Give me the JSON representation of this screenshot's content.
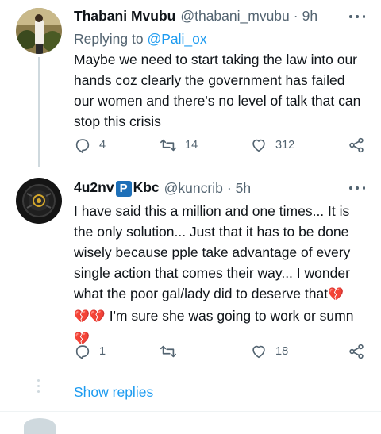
{
  "tweets": [
    {
      "name": "Thabani Mvubu",
      "handle": "@thabani_mvubu",
      "time": "9h",
      "replying_label": "Replying to",
      "replying_to": "@Pali_ox",
      "text": "Maybe we need to start taking the law into our hands coz clearly the government has failed our women and there's no level of talk that can stop this crisis",
      "replies": "4",
      "retweets": "14",
      "likes": "312"
    },
    {
      "name_prefix": "4u2nv",
      "name_badge": "P",
      "name_suffix": "Kbc",
      "handle": "@kuncrib",
      "time": "5h",
      "text": "I have said this a million and one times... It is the only solution... Just that it has to be done wisely because pple take advantage of every single action that comes their way... I wonder what the poor gal/lady did to deserve that",
      "text_hearts_1": "💔",
      "text_line2_hearts": "💔💔",
      "text_cont": " I'm sure she was going to work or sumn",
      "text_hearts_2": "💔",
      "replies": "1",
      "retweets": "",
      "likes": "18"
    }
  ],
  "show_replies": "Show replies",
  "colors": {
    "accent": "#1d9bf0",
    "muted": "#536471",
    "text": "#0f1419",
    "line": "#cfd9de"
  }
}
